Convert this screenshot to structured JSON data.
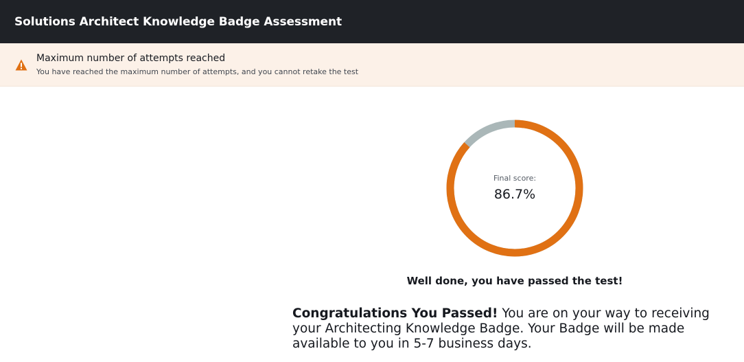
{
  "header": {
    "title": "Solutions Architect Knowledge Badge Assessment"
  },
  "alert": {
    "icon": "warning-triangle-icon",
    "title": "Maximum number of attempts reached",
    "text": "You have reached the maximum number of attempts, and you cannot retake the test",
    "color": "#e07114"
  },
  "score": {
    "label": "Final score:",
    "value_text": "86.7%",
    "fraction": 0.867,
    "fill_color": "#e07114",
    "track_color": "#aab7b8"
  },
  "result": {
    "message": "Well done, you have passed the test!",
    "congrats_heading": "Congratulations You Passed!",
    "congrats_body": "You are on your way to receiving your Architecting Knowledge Badge. Your Badge will be made available to you in 5-7 business days."
  }
}
